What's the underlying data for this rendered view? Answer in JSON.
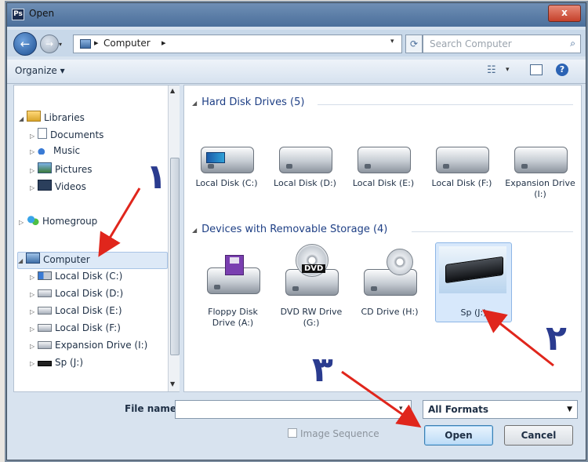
{
  "window": {
    "title": "Open",
    "close_label": "x"
  },
  "nav": {
    "back_label": "←",
    "forward_label": "→",
    "address_path": "Computer",
    "search_placeholder": "Search Computer"
  },
  "toolbar": {
    "organize_label": "Organize ▾"
  },
  "sidebar": {
    "items": [
      {
        "label": "Libraries",
        "icon": "library-icon"
      },
      {
        "label": "Documents",
        "icon": "documents-icon"
      },
      {
        "label": "Music",
        "icon": "music-icon"
      },
      {
        "label": "Pictures",
        "icon": "pictures-icon"
      },
      {
        "label": "Videos",
        "icon": "videos-icon"
      },
      {
        "label": "Homegroup",
        "icon": "homegroup-icon"
      },
      {
        "label": "Computer",
        "icon": "computer-icon"
      },
      {
        "label": "Local Disk (C:)",
        "icon": "system-disk-icon"
      },
      {
        "label": "Local Disk (D:)",
        "icon": "disk-icon"
      },
      {
        "label": "Local Disk (E:)",
        "icon": "disk-icon"
      },
      {
        "label": "Local Disk (F:)",
        "icon": "disk-icon"
      },
      {
        "label": "Expansion Drive (I:)",
        "icon": "disk-icon"
      },
      {
        "label": "Sp (J:)",
        "icon": "usb-drive-icon"
      }
    ]
  },
  "content": {
    "hard_disks_header": "Hard Disk Drives (5)",
    "hard_disks": [
      {
        "label": "Local Disk (C:)"
      },
      {
        "label": "Local Disk (D:)"
      },
      {
        "label": "Local Disk (E:)"
      },
      {
        "label": "Local Disk (F:)"
      },
      {
        "label": "Expansion Drive (I:)"
      }
    ],
    "removable_header": "Devices with Removable Storage (4)",
    "removable": [
      {
        "label": "Floppy Disk Drive (A:)"
      },
      {
        "label": "DVD RW Drive (G:)"
      },
      {
        "label": "CD Drive (H:)"
      },
      {
        "label": "Sp (J:)"
      }
    ],
    "dvd_badge": "DVD"
  },
  "footer": {
    "file_name_label": "File name:",
    "file_name_value": "",
    "filter_value": "All Formats",
    "image_sequence_label": "Image Sequence",
    "open_label": "Open",
    "cancel_label": "Cancel"
  },
  "annotations": {
    "step1": "١",
    "step2": "٢",
    "step3": "٣",
    "arrow_color": "#e0261c",
    "number_color": "#2a3b8f"
  }
}
